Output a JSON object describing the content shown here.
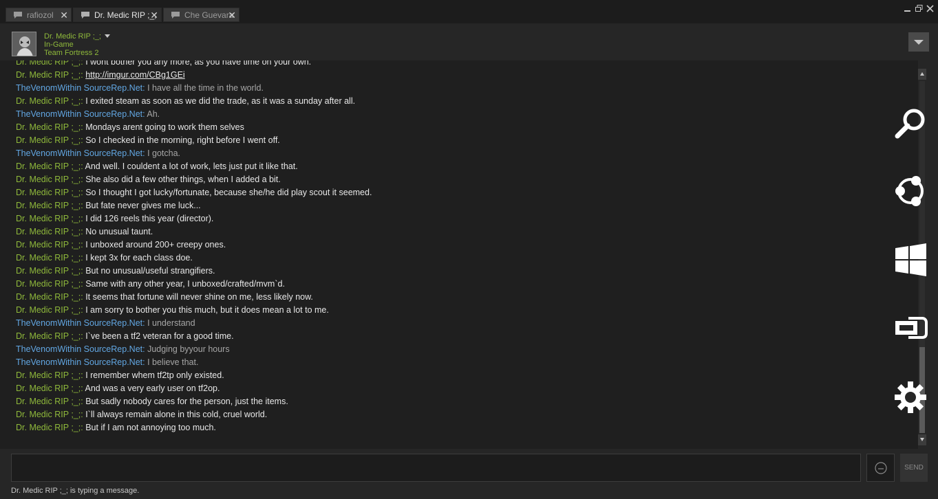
{
  "tabs": [
    {
      "label": "rafiozol",
      "active": false
    },
    {
      "label": "Dr. Medic RIP ;_;",
      "active": true
    },
    {
      "label": "Che Guevara",
      "active": false
    }
  ],
  "header": {
    "name": "Dr. Medic RIP ;_;",
    "status": "In-Game",
    "game": "Team Fortress 2"
  },
  "colors": {
    "friend_name": "#8fb93b",
    "self_name": "#62a7e3",
    "background": "#1f1f1f"
  },
  "messages": [
    {
      "sender": "Dr. Medic RIP ;_;",
      "side": "friend",
      "text": "I wont bother you any more, as you have time on your own.",
      "partial": true
    },
    {
      "sender": "Dr. Medic RIP ;_;",
      "side": "friend",
      "text": "http://imgur.com/CBg1GEi",
      "link": true
    },
    {
      "sender": "TheVenomWithin SourceRep.Net",
      "side": "self",
      "text": "I have all the time in the world."
    },
    {
      "sender": "Dr. Medic RIP ;_;",
      "side": "friend",
      "text": "I exited steam as soon as we did the trade, as it was a sunday after all."
    },
    {
      "sender": "TheVenomWithin SourceRep.Net",
      "side": "self",
      "text": "Ah."
    },
    {
      "sender": "Dr. Medic RIP ;_;",
      "side": "friend",
      "text": "Mondays arent going to work them selves"
    },
    {
      "sender": "Dr. Medic RIP ;_;",
      "side": "friend",
      "text": "So I checked in the morning, right before I went off."
    },
    {
      "sender": "TheVenomWithin SourceRep.Net",
      "side": "self",
      "text": "I gotcha."
    },
    {
      "sender": "Dr. Medic RIP ;_;",
      "side": "friend",
      "text": "And well. I couldent a lot of work, lets just put it like that."
    },
    {
      "sender": "Dr. Medic RIP ;_;",
      "side": "friend",
      "text": "She also did a few other things, when I added a bit."
    },
    {
      "sender": "Dr. Medic RIP ;_;",
      "side": "friend",
      "text": "So I thought I got lucky/fortunate, because she/he did play scout it seemed."
    },
    {
      "sender": "Dr. Medic RIP ;_;",
      "side": "friend",
      "text": "But fate never gives me luck..."
    },
    {
      "sender": "Dr. Medic RIP ;_;",
      "side": "friend",
      "text": "I did 126 reels this year (director)."
    },
    {
      "sender": "Dr. Medic RIP ;_;",
      "side": "friend",
      "text": "No unusual taunt."
    },
    {
      "sender": "Dr. Medic RIP ;_;",
      "side": "friend",
      "text": "I unboxed around 200+ creepy ones."
    },
    {
      "sender": "Dr. Medic RIP ;_;",
      "side": "friend",
      "text": "I kept 3x for each class doe."
    },
    {
      "sender": "Dr. Medic RIP ;_;",
      "side": "friend",
      "text": "But no unusual/useful strangifiers."
    },
    {
      "sender": "Dr. Medic RIP ;_;",
      "side": "friend",
      "text": "Same with any other year, I unboxed/crafted/mvm`d."
    },
    {
      "sender": "Dr. Medic RIP ;_;",
      "side": "friend",
      "text": "It seems that fortune will never shine on me, less likely now."
    },
    {
      "sender": "Dr. Medic RIP ;_;",
      "side": "friend",
      "text": "I am sorry to bother you this much, but it does mean a lot to me."
    },
    {
      "sender": "TheVenomWithin SourceRep.Net",
      "side": "self",
      "text": "I understand"
    },
    {
      "sender": "Dr. Medic RIP ;_;",
      "side": "friend",
      "text": "I`ve been a tf2 veteran for a good time."
    },
    {
      "sender": "TheVenomWithin SourceRep.Net",
      "side": "self",
      "text": "Judging byyour hours"
    },
    {
      "sender": "TheVenomWithin SourceRep.Net",
      "side": "self",
      "text": "I believe that."
    },
    {
      "sender": "Dr. Medic RIP ;_;",
      "side": "friend",
      "text": "I remember whem tf2tp only existed."
    },
    {
      "sender": "Dr. Medic RIP ;_;",
      "side": "friend",
      "text": "And was a very early user on tf2op."
    },
    {
      "sender": "Dr. Medic RIP ;_;",
      "side": "friend",
      "text": "But sadly nobody cares for the person, just the items."
    },
    {
      "sender": "Dr. Medic RIP ;_;",
      "side": "friend",
      "text": "I`ll always remain alone in this cold, cruel world."
    },
    {
      "sender": "Dr. Medic RIP ;_;",
      "side": "friend",
      "text": "But if I am not annoying too much."
    }
  ],
  "side_icons": [
    "search-icon",
    "share-icon",
    "windows-icon",
    "connect-icon",
    "gear-icon"
  ],
  "input": {
    "value": "",
    "placeholder": ""
  },
  "send_label": "SEND",
  "typing_status": "Dr. Medic RIP ;_; is typing a message."
}
